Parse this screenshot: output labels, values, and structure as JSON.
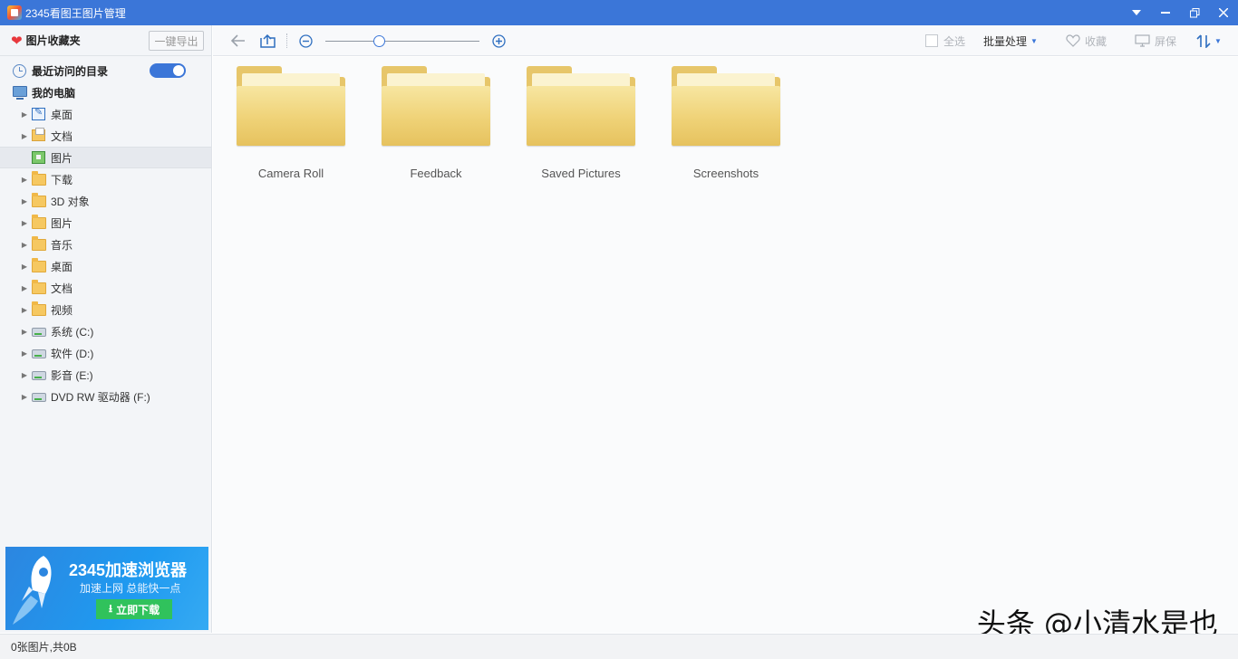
{
  "window": {
    "title": "2345看图王图片管理"
  },
  "sidebar": {
    "favorites_title": "图片收藏夹",
    "export_label": "一键导出",
    "recent_label": "最近访问的目录",
    "recent_toggle_on": true,
    "pc_label": "我的电脑",
    "items": [
      {
        "label": "桌面",
        "icon": "desktop-icon"
      },
      {
        "label": "文档",
        "icon": "documents-icon"
      },
      {
        "label": "图片",
        "icon": "pictures-icon",
        "selected": true
      },
      {
        "label": "下载",
        "icon": "folder-icon"
      },
      {
        "label": "3D 对象",
        "icon": "folder-icon"
      },
      {
        "label": "图片",
        "icon": "folder-icon"
      },
      {
        "label": "音乐",
        "icon": "folder-icon"
      },
      {
        "label": "桌面",
        "icon": "folder-icon"
      },
      {
        "label": "文档",
        "icon": "folder-icon"
      },
      {
        "label": "视频",
        "icon": "folder-icon"
      },
      {
        "label": "系统 (C:)",
        "icon": "drive-icon"
      },
      {
        "label": "软件 (D:)",
        "icon": "drive-icon"
      },
      {
        "label": "影音 (E:)",
        "icon": "drive-icon"
      },
      {
        "label": "DVD  RW 驱动器 (F:)",
        "icon": "drive-icon"
      }
    ]
  },
  "ad": {
    "title": "2345加速浏览器",
    "subtitle": "加速上网 总能快一点",
    "button": "立即下载"
  },
  "toolbar": {
    "select_all": "全选",
    "batch": "批量处理",
    "favorite": "收藏",
    "screensaver": "屏保",
    "zoom_level": 0.35
  },
  "folders": [
    {
      "name": "Camera Roll"
    },
    {
      "name": "Feedback"
    },
    {
      "name": "Saved Pictures"
    },
    {
      "name": "Screenshots"
    }
  ],
  "status": {
    "text": "0张图片,共0B"
  },
  "watermark": "头条 @小清水是也",
  "colors": {
    "titlebar": "#3b76d8",
    "accent": "#3b76d8",
    "folder": "#efd277",
    "ad_button": "#30c25c"
  }
}
